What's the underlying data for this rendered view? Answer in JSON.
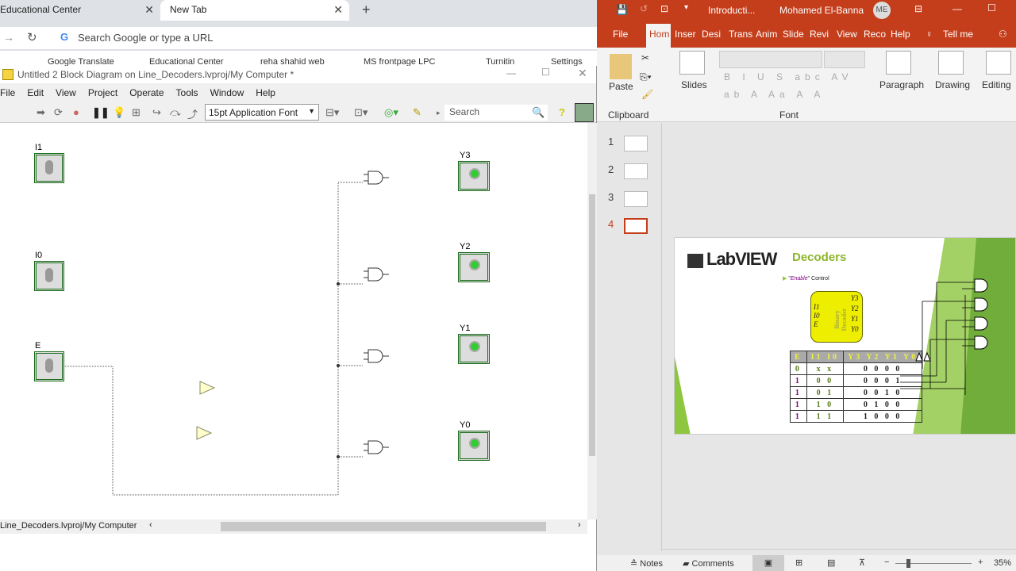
{
  "browser": {
    "tabs": [
      {
        "label": "Educational Center"
      },
      {
        "label": "New Tab"
      }
    ],
    "address_placeholder": "Search Google or type a URL",
    "bookmarks": [
      "Google Translate",
      "Educational Center",
      "reha shahid web",
      "MS frontpage LPC",
      "Turnitin",
      "Settings"
    ]
  },
  "labview": {
    "title": "Untitled 2 Block Diagram on Line_Decoders.lvproj/My Computer *",
    "menu": [
      "File",
      "Edit",
      "View",
      "Project",
      "Operate",
      "Tools",
      "Window",
      "Help"
    ],
    "font_select": "15pt Application Font",
    "search_placeholder": "Search",
    "controls": [
      {
        "label": "I1"
      },
      {
        "label": "I0"
      },
      {
        "label": "E"
      }
    ],
    "indicators": [
      {
        "label": "Y3"
      },
      {
        "label": "Y2"
      },
      {
        "label": "Y1"
      },
      {
        "label": "Y0"
      }
    ],
    "status_path": "Line_Decoders.lvproj/My Computer"
  },
  "ppt": {
    "doc_title": "Introducti...",
    "user": "Mohamed El-Banna",
    "avatar": "ME",
    "tabs": [
      "File",
      "Hom",
      "Inser",
      "Desi",
      "Trans",
      "Anim",
      "Slide",
      "Revi",
      "View",
      "Reco",
      "Help"
    ],
    "tell_me": "Tell me",
    "ribbon": {
      "paste": "Paste",
      "clipboard": "Clipboard",
      "slides": "Slides",
      "font": "Font",
      "paragraph": "Paragraph",
      "drawing": "Drawing",
      "editing": "Editing"
    },
    "thumbnails": [
      "1",
      "2",
      "3",
      "4"
    ],
    "active_slide": 4,
    "slide": {
      "logo": "LabVIEW",
      "title": "Decoders",
      "bullet_pre": "\"",
      "bullet_em": "Enable",
      "bullet_post": "\" Control",
      "block_label": "Binary Decoder",
      "inputs": [
        "I1",
        "I0",
        "E"
      ],
      "outputs": [
        "Y3",
        "Y2",
        "Y1",
        "Y0"
      ],
      "truth_table": {
        "header": [
          "E",
          "I1 I0",
          "Y3 Y2 Y1 Y0"
        ],
        "rows": [
          [
            "0",
            "x x",
            "0 0 0 0"
          ],
          [
            "1",
            "0 0",
            "0 0 0 1"
          ],
          [
            "1",
            "0 1",
            "0 0 1 0"
          ],
          [
            "1",
            "1 0",
            "0 1 0 0"
          ],
          [
            "1",
            "1 1",
            "1 0 0 0"
          ]
        ]
      }
    },
    "status": {
      "notes": "Notes",
      "comments": "Comments",
      "zoom": "35%"
    }
  }
}
